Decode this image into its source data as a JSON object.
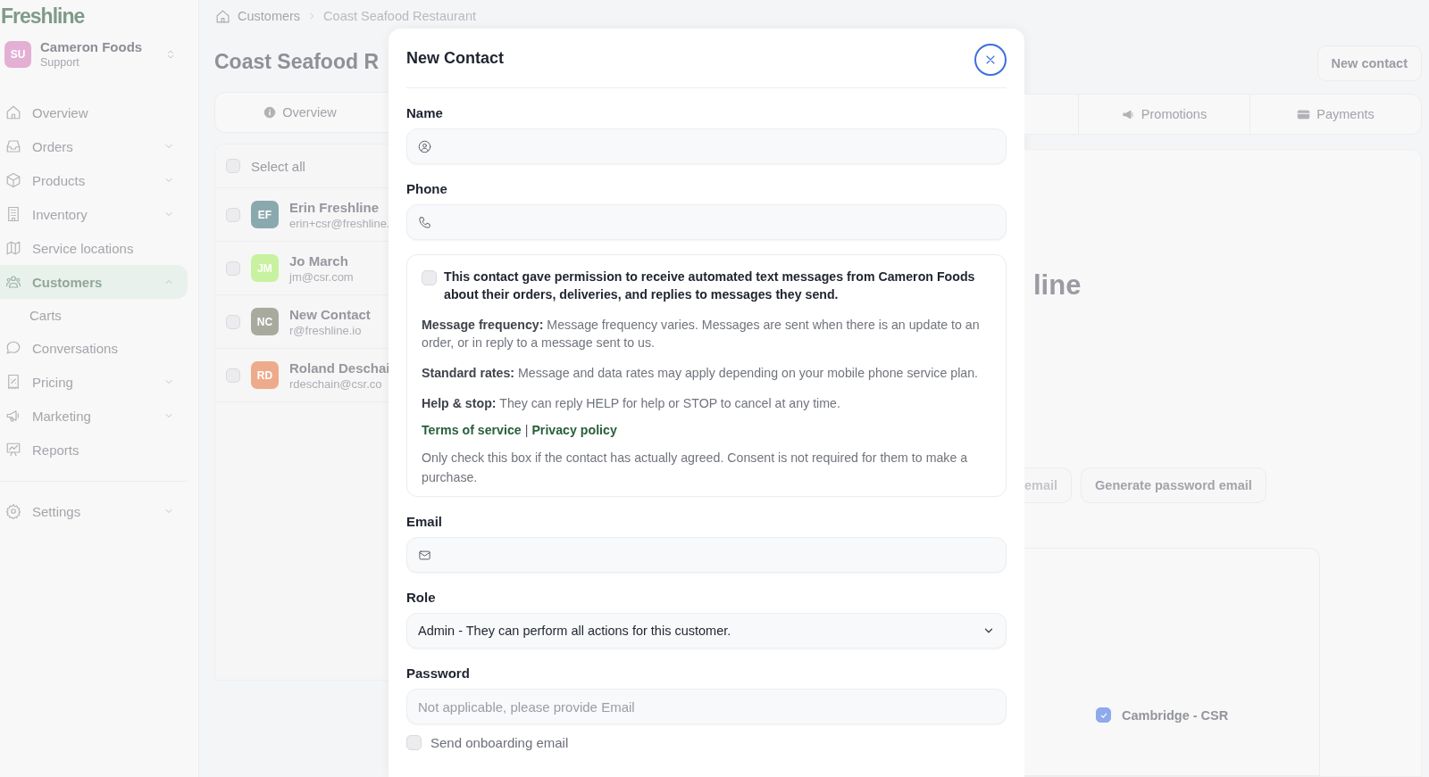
{
  "sidebar": {
    "logo": "Freshline",
    "account": {
      "initials": "SU",
      "name": "Cameron Foods",
      "role": "Support"
    },
    "items": [
      {
        "label": "Overview",
        "kind": "link",
        "selected": false
      },
      {
        "label": "Orders",
        "kind": "group",
        "expanded": false,
        "selected": false
      },
      {
        "label": "Products",
        "kind": "group",
        "expanded": false,
        "selected": false
      },
      {
        "label": "Inventory",
        "kind": "group",
        "expanded": false,
        "selected": false
      },
      {
        "label": "Service locations",
        "kind": "link",
        "selected": false
      },
      {
        "label": "Customers",
        "kind": "group",
        "expanded": true,
        "selected": true,
        "children": [
          {
            "label": "Carts",
            "selected": false
          }
        ]
      },
      {
        "label": "Conversations",
        "kind": "link",
        "selected": false
      },
      {
        "label": "Pricing",
        "kind": "group",
        "expanded": false,
        "selected": false
      },
      {
        "label": "Marketing",
        "kind": "group",
        "expanded": false,
        "selected": false
      },
      {
        "label": "Reports",
        "kind": "link",
        "selected": false
      },
      {
        "label": "Settings",
        "kind": "group",
        "expanded": false,
        "selected": false
      }
    ]
  },
  "breadcrumb": [
    "Customers",
    "Coast Seafood Restaurant"
  ],
  "left_panel": {
    "title": "Coast Seafood R",
    "tabs": [
      "Overview"
    ],
    "select_all": {
      "label": "Select all",
      "checked": false
    },
    "contacts": [
      {
        "initials": "EF",
        "name": "Erin Freshline",
        "email": "erin+csr@freshline.",
        "color": "#8aa9ae",
        "checked": false
      },
      {
        "initials": "JM",
        "name": "Jo March",
        "email": "jm@csr.com",
        "color": "#c8f2a0",
        "checked": false
      },
      {
        "initials": "NC",
        "name": "New Contact",
        "email": "r@freshline.io",
        "color": "#a8aa9e",
        "checked": false
      },
      {
        "initials": "RD",
        "name": "Roland Deschai",
        "email": "rdeschain@csr.co",
        "color": "#eeab8c",
        "checked": false
      }
    ]
  },
  "right_panel": {
    "new_contact_button": "New contact",
    "tabs": [
      "Promotions",
      "Payments"
    ],
    "heading": "line",
    "buttons": [
      "email",
      "Generate password email"
    ],
    "location": {
      "label": "Cambridge - CSR",
      "checked": true
    }
  },
  "modal": {
    "title": "New Contact",
    "name_field": {
      "label": "Name"
    },
    "phone_field": {
      "label": "Phone"
    },
    "consent": {
      "checked": false,
      "statement": "This contact gave permission to receive automated text messages from Cameron Foods about their orders, deliveries, and replies to messages they send.",
      "notes": [
        "**Message frequency:** Message frequency varies. Messages are sent when there is an update to an order, or in reply to a message sent to us.",
        "**Standard rates:** Message and data rates may apply depending on your mobile phone service plan.",
        "**Help & stop:** They can reply HELP for help or STOP to cancel at any time."
      ],
      "links": [
        "Terms of service",
        "Privacy policy"
      ],
      "separator": "|",
      "footnote": "Only check this box if the contact has actually agreed. Consent is not required for them to make a purchase."
    },
    "email_field": {
      "label": "Email"
    },
    "role_field": {
      "label": "Role",
      "value": "Admin - They can perform all actions for this customer."
    },
    "password_field": {
      "label": "Password",
      "placeholder": "Not applicable, please provide Email"
    },
    "onboarding": {
      "label": "Send onboarding email",
      "checked": false
    }
  }
}
